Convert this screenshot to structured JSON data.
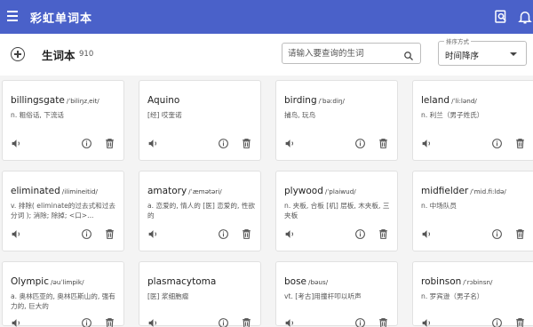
{
  "app": {
    "title": "彩虹单词本"
  },
  "toolbar": {
    "book_title": "生词本",
    "count": "910",
    "search_placeholder": "请输入要查询的生词",
    "sort_label": "排序方式",
    "sort_value": "时间降序"
  },
  "cards": [
    {
      "word": "billingsgate",
      "phonetic": "/ˈbiliŋzˌeit/",
      "definition": "n. 粗俗话, 下流话"
    },
    {
      "word": "Aquino",
      "phonetic": "",
      "definition": "[经] 哎奎诺"
    },
    {
      "word": "birding",
      "phonetic": "/ˈbəːdiŋ/",
      "definition": "捕鸟, 玩鸟"
    },
    {
      "word": "leland",
      "phonetic": "/ˈli:lənd/",
      "definition": "n. 利兰（男子姓氏）"
    },
    {
      "word": "eliminated",
      "phonetic": "/ilimineitid/",
      "definition": "v. 排除( eliminate的过去式和过去分词 ); 消除; 除掉; <口>..."
    },
    {
      "word": "amatory",
      "phonetic": "/ˈæmətəri/",
      "definition": "a. 恋爱的, 情人的 [医] 恋爱的, 性欲的"
    },
    {
      "word": "plywood",
      "phonetic": "/ˈplaiwud/",
      "definition": "n. 夹板, 合板 [机] 层板, 木夹板, 三夹板"
    },
    {
      "word": "midfielder",
      "phonetic": "/ˈmid.fi:ldə/",
      "definition": "n. 中场队员"
    },
    {
      "word": "Olympic",
      "phonetic": "/əuˈlimpik/",
      "definition": "a. 奥林匹亚的, 奥林匹斯山的, 强有力的, 巨大的"
    },
    {
      "word": "plasmacytoma",
      "phonetic": "",
      "definition": "[医] 浆细胞瘤"
    },
    {
      "word": "bose",
      "phonetic": "/bəus/",
      "definition": "vt. [考古]用撞杆叩以听声"
    },
    {
      "word": "robinson",
      "phonetic": "/ˈrɔbinsn/",
      "definition": "n. 罗宾逊（男子名）"
    }
  ]
}
